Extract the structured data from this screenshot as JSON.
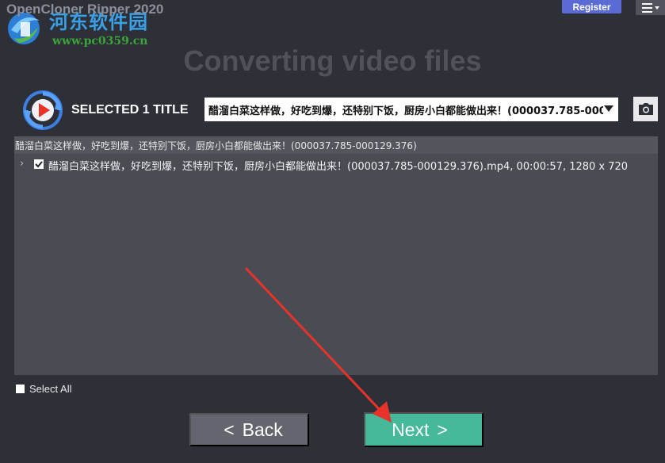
{
  "app": {
    "title": "OpenCloner Ripper 2020",
    "register_label": "Register",
    "menu_icon": "hamburger-menu-icon"
  },
  "watermark": {
    "site_name": "河东软件园",
    "url": "www.pc0359.cn"
  },
  "page": {
    "heading": "Converting video files"
  },
  "title_select": {
    "selected_label": "SELECTED 1 TITLE",
    "dropdown_value": "醋溜白菜这样做，好吃到爆，还特别下饭，厨房小白都能做出来！(000037.785-000129.376)",
    "snapshot_icon": "camera-icon"
  },
  "list": {
    "header": "醋溜白菜这样做，好吃到爆，还特别下饭，厨房小白都能做出来！(000037.785-000129.376)",
    "items": [
      {
        "label": "醋溜白菜这样做，好吃到爆，还特别下饭，厨房小白都能做出来！(000037.785-000129.376).mp4, 00:00:57, 1280 x 720",
        "checked": true
      }
    ]
  },
  "select_all": {
    "label": "Select All",
    "checked": false
  },
  "buttons": {
    "back_label": "Back",
    "back_chevron": "<",
    "next_label": "Next",
    "next_chevron": ">"
  },
  "colors": {
    "background": "#2e3037",
    "panel": "#4a4c53",
    "accent_next": "#45b99a",
    "register": "#5b6bd6",
    "annotation_arrow": "#e8322a"
  }
}
